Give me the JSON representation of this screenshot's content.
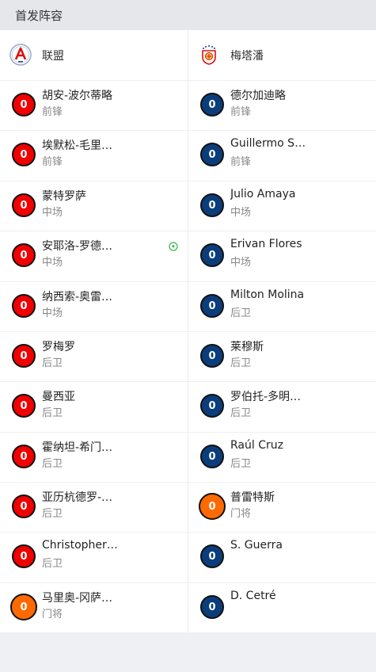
{
  "header": {
    "title": "首发阵容"
  },
  "home": {
    "name": "联盟",
    "logo_icon": "club-crest-a-icon",
    "players": [
      {
        "number": "0",
        "name": "胡安-波尔蒂略",
        "position": "前锋",
        "color": "red"
      },
      {
        "number": "0",
        "name": "埃默松-毛里…",
        "position": "前锋",
        "color": "red"
      },
      {
        "number": "0",
        "name": "蒙特罗萨",
        "position": "中场",
        "color": "red"
      },
      {
        "number": "0",
        "name": "安耶洛-罗德…",
        "position": "中场",
        "color": "red",
        "event_icon": "goal-ball-icon"
      },
      {
        "number": "0",
        "name": "纳西索-奥雷…",
        "position": "中场",
        "color": "red"
      },
      {
        "number": "0",
        "name": "罗梅罗",
        "position": "后卫",
        "color": "red"
      },
      {
        "number": "0",
        "name": "曼西亚",
        "position": "后卫",
        "color": "red"
      },
      {
        "number": "0",
        "name": "霍纳坦-希门…",
        "position": "后卫",
        "color": "red"
      },
      {
        "number": "0",
        "name": "亚历杭德罗-…",
        "position": "后卫",
        "color": "red"
      },
      {
        "number": "0",
        "name": "Christopher …",
        "position": "后卫",
        "color": "red"
      },
      {
        "number": "0",
        "name": "马里奥-冈萨…",
        "position": "门将",
        "color": "orange"
      }
    ]
  },
  "away": {
    "name": "梅塔潘",
    "logo_icon": "club-crest-stars-icon",
    "players": [
      {
        "number": "0",
        "name": "德尔加迪略",
        "position": "前锋",
        "color": "blue"
      },
      {
        "number": "0",
        "name": "Guillermo Str…",
        "position": "前锋",
        "color": "blue"
      },
      {
        "number": "0",
        "name": "Julio Amaya",
        "position": "中场",
        "color": "blue"
      },
      {
        "number": "0",
        "name": "Erivan Flores",
        "position": "中场",
        "color": "blue"
      },
      {
        "number": "0",
        "name": "Milton Molina",
        "position": "后卫",
        "color": "blue"
      },
      {
        "number": "0",
        "name": "莱穆斯",
        "position": "后卫",
        "color": "blue"
      },
      {
        "number": "0",
        "name": "罗伯托-多明…",
        "position": "后卫",
        "color": "blue"
      },
      {
        "number": "0",
        "name": "Raúl Cruz",
        "position": "后卫",
        "color": "blue"
      },
      {
        "number": "0",
        "name": "普雷特斯",
        "position": "门将",
        "color": "orange"
      },
      {
        "number": "0",
        "name": "S. Guerra",
        "position": "",
        "color": "blue"
      },
      {
        "number": "0",
        "name": "D. Cetré",
        "position": "",
        "color": "blue"
      }
    ]
  },
  "colors": {
    "red": "#f00000",
    "blue": "#0a3d7a",
    "orange": "#ff6a00",
    "goal_icon": "#2db84b"
  }
}
